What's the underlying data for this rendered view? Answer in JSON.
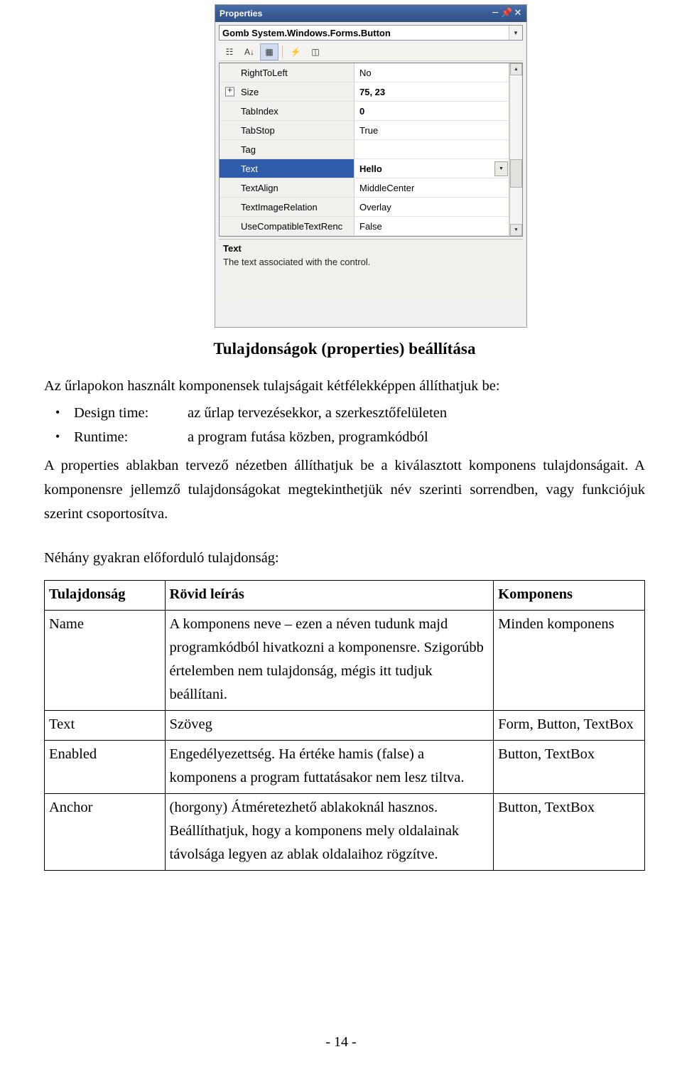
{
  "screenshot": {
    "window_title": "Properties",
    "titlebar_buttons": [
      "minimize",
      "pin",
      "close"
    ],
    "object_combo": {
      "value": "Gomb System.Windows.Forms.Button",
      "name_part": "Gomb",
      "type_part": "System.Windows.Forms.Button"
    },
    "toolbar_icons": [
      "categorized-icon",
      "alphabetical-sort-icon",
      "properties-icon",
      "events-icon",
      "property-pages-icon"
    ],
    "grid_rows": [
      {
        "name": "RightToLeft",
        "value": "No",
        "bold": false,
        "expandable": false,
        "selected": false,
        "dropdown": false
      },
      {
        "name": "Size",
        "value": "75, 23",
        "bold": true,
        "expandable": true,
        "selected": false,
        "dropdown": false
      },
      {
        "name": "TabIndex",
        "value": "0",
        "bold": true,
        "expandable": false,
        "selected": false,
        "dropdown": false
      },
      {
        "name": "TabStop",
        "value": "True",
        "bold": false,
        "expandable": false,
        "selected": false,
        "dropdown": false
      },
      {
        "name": "Tag",
        "value": "",
        "bold": false,
        "expandable": false,
        "selected": false,
        "dropdown": false
      },
      {
        "name": "Text",
        "value": "Hello",
        "bold": true,
        "expandable": false,
        "selected": true,
        "dropdown": true
      },
      {
        "name": "TextAlign",
        "value": "MiddleCenter",
        "bold": false,
        "expandable": false,
        "selected": false,
        "dropdown": false
      },
      {
        "name": "TextImageRelation",
        "value": "Overlay",
        "bold": false,
        "expandable": false,
        "selected": false,
        "dropdown": false
      },
      {
        "name": "UseCompatibleTextRenc",
        "value": "False",
        "bold": false,
        "expandable": false,
        "selected": false,
        "dropdown": false
      }
    ],
    "description": {
      "title": "Text",
      "body": "The text associated with the control."
    }
  },
  "document": {
    "heading": "Tulajdonságok (properties) beállítása",
    "intro": "Az űrlapokon használt komponensek tulajságait kétfélekképpen állíthatjuk be:",
    "bullets": [
      {
        "label": "Design time:",
        "text": "az űrlap tervezésekkor, a szerkesztőfelületen"
      },
      {
        "label": "Runtime:",
        "text": "a program futása közben, programkódból"
      }
    ],
    "paragraph1": "A properties ablakban tervező nézetben állíthatjuk be a kiválasztott komponens tulajdonságait. A komponensre jellemző tulajdonságokat megtekinthetjük név szerinti sorrendben, vagy funkciójuk szerint csoportosítva.",
    "paragraph2": "Néhány gyakran előforduló tulajdonság:",
    "table": {
      "headers": [
        "Tulajdonság",
        "Rövid leírás",
        "Komponens"
      ],
      "rows": [
        {
          "property": "Name",
          "description": "A komponens neve – ezen a néven tudunk majd programkódból hivatkozni a komponensre. Szigorúbb értelemben nem tulajdonság, mégis itt tudjuk beállítani.",
          "component": "Minden komponens"
        },
        {
          "property": "Text",
          "description": "Szöveg",
          "component": "Form, Button, TextBox"
        },
        {
          "property": "Enabled",
          "description": "Engedélyezettség. Ha értéke hamis (false) a komponens a program futtatásakor nem lesz tiltva.",
          "component": "Button, TextBox"
        },
        {
          "property": "Anchor",
          "description": "(horgony) Átméretezhető ablakoknál hasznos. Beállíthatjuk, hogy a komponens mely oldalainak távolsága legyen az ablak oldalaihoz rögzítve.",
          "component": "Button, TextBox"
        }
      ]
    },
    "page_number": "- 14 -"
  }
}
